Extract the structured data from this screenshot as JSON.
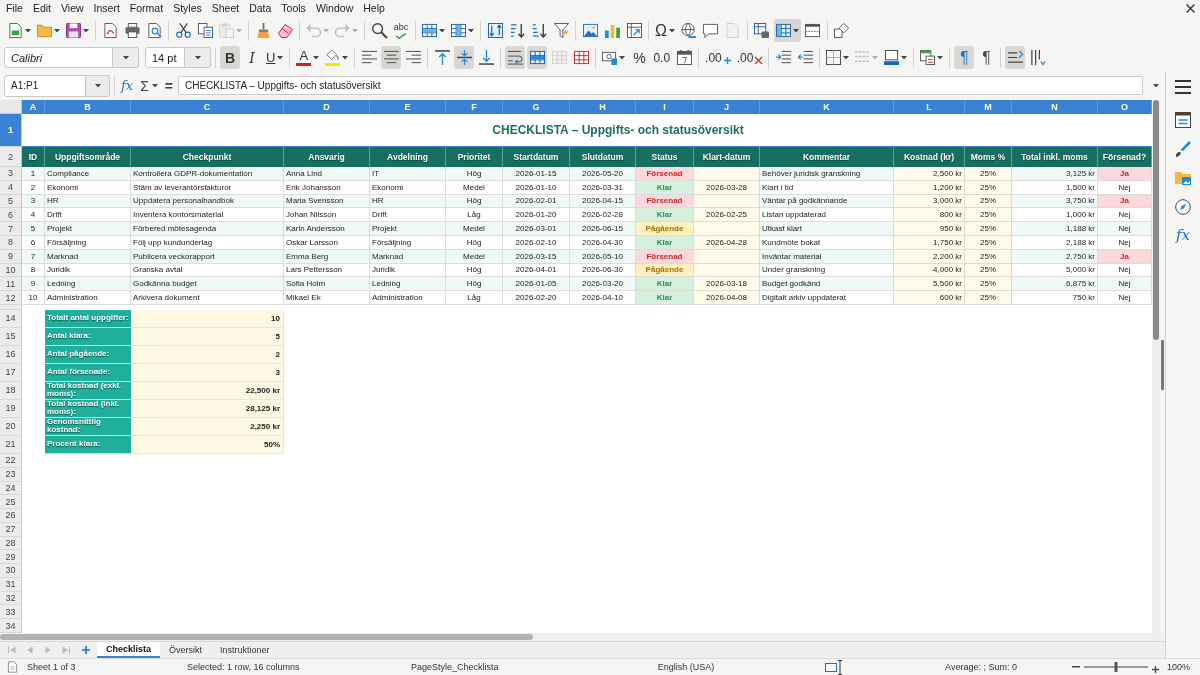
{
  "menu_bar": {
    "items": [
      "File",
      "Edit",
      "View",
      "Insert",
      "Format",
      "Styles",
      "Sheet",
      "Data",
      "Tools",
      "Window",
      "Help"
    ]
  },
  "standard_toolbar": {
    "groups": [
      [
        {
          "kind": "new",
          "menu": true,
          "pressed": false,
          "disabled": false
        },
        {
          "kind": "open",
          "menu": true,
          "pressed": false,
          "disabled": false
        },
        {
          "kind": "save",
          "menu": true,
          "pressed": false,
          "disabled": false
        }
      ],
      [
        {
          "kind": "pdf",
          "menu": false,
          "pressed": false,
          "disabled": false
        },
        {
          "kind": "print",
          "menu": false,
          "pressed": false,
          "disabled": false
        },
        {
          "kind": "preview",
          "menu": false,
          "pressed": false,
          "disabled": false
        }
      ],
      [
        {
          "kind": "cut",
          "menu": false,
          "pressed": false,
          "disabled": false
        },
        {
          "kind": "copy",
          "menu": false,
          "pressed": false,
          "disabled": false
        },
        {
          "kind": "paste",
          "menu": true,
          "pressed": false,
          "disabled": true
        }
      ],
      [
        {
          "kind": "clone",
          "menu": false,
          "pressed": false,
          "disabled": false
        },
        {
          "kind": "clear",
          "menu": false,
          "pressed": false,
          "disabled": false
        }
      ],
      [
        {
          "kind": "undo",
          "menu": true,
          "pressed": false,
          "disabled": true
        },
        {
          "kind": "redo",
          "menu": true,
          "pressed": false,
          "disabled": true
        }
      ],
      [
        {
          "kind": "find",
          "menu": false,
          "pressed": false,
          "disabled": false
        },
        {
          "kind": "spelling",
          "label": "abc",
          "menu": false,
          "pressed": false,
          "disabled": false
        }
      ],
      [
        {
          "kind": "rows",
          "menu": true,
          "pressed": false,
          "disabled": false
        },
        {
          "kind": "columns",
          "menu": true,
          "pressed": false,
          "disabled": false
        }
      ],
      [
        {
          "kind": "sort",
          "menu": false,
          "pressed": false,
          "disabled": false
        },
        {
          "kind": "sortup",
          "menu": false,
          "pressed": false,
          "disabled": false
        },
        {
          "kind": "sortdown",
          "menu": false,
          "pressed": false,
          "disabled": false
        },
        {
          "kind": "filter",
          "menu": false,
          "pressed": false,
          "disabled": false
        }
      ],
      [
        {
          "kind": "image",
          "menu": false,
          "pressed": false,
          "disabled": false
        },
        {
          "kind": "chart",
          "menu": false,
          "pressed": false,
          "disabled": false
        },
        {
          "kind": "pivot",
          "menu": false,
          "pressed": false,
          "disabled": false
        }
      ],
      [
        {
          "kind": "symbol",
          "label": "Ω",
          "menu": true,
          "pressed": false,
          "disabled": false
        },
        {
          "kind": "link",
          "menu": false,
          "pressed": false,
          "disabled": false
        },
        {
          "kind": "comment",
          "menu": false,
          "pressed": false,
          "disabled": false
        },
        {
          "kind": "headers",
          "menu": false,
          "pressed": false,
          "disabled": true
        }
      ],
      [
        {
          "kind": "printrange",
          "menu": false,
          "pressed": false,
          "disabled": false
        },
        {
          "kind": "freeze",
          "menu": true,
          "pressed": true,
          "disabled": false
        },
        {
          "kind": "split",
          "menu": false,
          "pressed": false,
          "disabled": false
        }
      ],
      [
        {
          "kind": "draw",
          "menu": false,
          "pressed": false,
          "disabled": false
        }
      ]
    ]
  },
  "formatting_toolbar": {
    "font_name": "Calibri",
    "font_size": "14 pt",
    "groups": [
      [
        {
          "kind": "bold",
          "label": "B",
          "menu": false,
          "pressed": true,
          "disabled": false
        },
        {
          "kind": "italic",
          "label": "I",
          "menu": false,
          "pressed": false,
          "disabled": false
        },
        {
          "kind": "underline",
          "label": "U",
          "menu": true,
          "pressed": false,
          "disabled": false
        }
      ],
      [
        {
          "kind": "fontcolor",
          "label": "A",
          "color": "#c62828",
          "menu": true,
          "pressed": false,
          "disabled": false
        },
        {
          "kind": "highlight",
          "color": "#f7e600",
          "menu": true,
          "pressed": false,
          "disabled": false
        }
      ],
      [
        {
          "kind": "alignleft",
          "menu": false,
          "pressed": false,
          "disabled": false
        },
        {
          "kind": "aligncenter",
          "menu": false,
          "pressed": true,
          "disabled": false
        },
        {
          "kind": "alignright",
          "menu": false,
          "pressed": false,
          "disabled": false
        }
      ],
      [
        {
          "kind": "aligntop",
          "menu": false,
          "pressed": false,
          "disabled": false
        },
        {
          "kind": "alignmiddle",
          "menu": false,
          "pressed": true,
          "disabled": false
        },
        {
          "kind": "alignbottom",
          "menu": false,
          "pressed": false,
          "disabled": false
        }
      ],
      [
        {
          "kind": "wrap",
          "menu": false,
          "pressed": true,
          "disabled": false
        },
        {
          "kind": "mergecenter",
          "menu": false,
          "pressed": true,
          "disabled": false
        },
        {
          "kind": "merge",
          "menu": false,
          "pressed": false,
          "disabled": true
        },
        {
          "kind": "unmerge",
          "menu": false,
          "pressed": false,
          "disabled": false
        }
      ],
      [
        {
          "kind": "currency",
          "menu": true,
          "pressed": false,
          "disabled": false
        },
        {
          "kind": "percent",
          "label": "%",
          "menu": false,
          "pressed": false,
          "disabled": false
        },
        {
          "kind": "number",
          "label": "0.0",
          "menu": false,
          "pressed": false,
          "disabled": false
        },
        {
          "kind": "date",
          "menu": false,
          "pressed": false,
          "disabled": false
        }
      ],
      [
        {
          "kind": "adddecimal",
          "label": ".00",
          "menu": false,
          "pressed": false,
          "disabled": false
        },
        {
          "kind": "deldecimal",
          "label": ".00",
          "menu": false,
          "pressed": false,
          "disabled": false
        }
      ],
      [
        {
          "kind": "indent",
          "menu": false,
          "pressed": false,
          "disabled": false
        },
        {
          "kind": "outdent",
          "menu": false,
          "pressed": false,
          "disabled": false
        }
      ],
      [
        {
          "kind": "borders",
          "menu": true,
          "pressed": false,
          "disabled": false
        },
        {
          "kind": "borderstyle",
          "menu": true,
          "pressed": false,
          "disabled": true
        },
        {
          "kind": "bordercolor",
          "menu": true,
          "pressed": false,
          "disabled": false
        }
      ],
      [
        {
          "kind": "conditional",
          "menu": true,
          "pressed": false,
          "disabled": false
        }
      ],
      [
        {
          "kind": "ltr",
          "label": "¶",
          "menu": false,
          "pressed": true,
          "disabled": false
        },
        {
          "kind": "rtl",
          "label": "¶",
          "menu": false,
          "pressed": false,
          "disabled": false
        }
      ],
      [
        {
          "kind": "horizontal",
          "menu": false,
          "pressed": true,
          "disabled": false
        },
        {
          "kind": "vertical",
          "menu": false,
          "pressed": false,
          "disabled": false
        }
      ]
    ]
  },
  "formula_bar": {
    "name_box": "A1:P1",
    "function_wizard": "fx",
    "sum": "Σ",
    "equals": "=",
    "content": "CHECKLISTA – Uppgifts- och statusöversikt"
  },
  "sheet": {
    "columns": [
      {
        "label": "A",
        "selected": true
      },
      {
        "label": "B",
        "selected": true
      },
      {
        "label": "C",
        "selected": true
      },
      {
        "label": "D",
        "selected": true
      },
      {
        "label": "E",
        "selected": true
      },
      {
        "label": "F",
        "selected": true
      },
      {
        "label": "G",
        "selected": true
      },
      {
        "label": "H",
        "selected": true
      },
      {
        "label": "I",
        "selected": true
      },
      {
        "label": "J",
        "selected": true
      },
      {
        "label": "K",
        "selected": true
      },
      {
        "label": "L",
        "selected": true
      },
      {
        "label": "M",
        "selected": true
      },
      {
        "label": "N",
        "selected": true
      },
      {
        "label": "O",
        "selected": true
      }
    ],
    "title_row": {
      "row": "1",
      "selected": true,
      "title": "CHECKLISTA – Uppgifts- och statusöversikt"
    },
    "header_row": {
      "row": "2",
      "selected": false,
      "cells": [
        "ID",
        "Uppgiftsområde",
        "Checkpunkt",
        "Ansvarig",
        "Avdelning",
        "Prioritet",
        "Startdatum",
        "Slutdatum",
        "Status",
        "Klart-datum",
        "Kommentar",
        "Kostnad (kr)",
        "Moms %",
        "Total inkl. moms",
        "Försenad?"
      ]
    },
    "rows": [
      {
        "row": "3",
        "selected": false,
        "id": "1",
        "area": "Compliance",
        "checkpoint": "Kontrollera GDPR-dokumentation",
        "owner": "Anna Lind",
        "department": "IT",
        "priority": "Hög",
        "start": "2026-01-15",
        "end": "2026-05-20",
        "status": {
          "text": "Försenad",
          "kind": "late"
        },
        "comment": "Behöver juridisk granskning",
        "cost": "2,500 kr",
        "vat": "25%",
        "total": "3,125 kr",
        "overdue": {
          "text": "Ja",
          "flagged": true
        }
      },
      {
        "row": "4",
        "selected": false,
        "id": "2",
        "area": "Ekonomi",
        "checkpoint": "Stäm av leverantörsfakturor",
        "owner": "Erik Johansson",
        "department": "Ekonomi",
        "priority": "Medel",
        "start": "2026-01-10",
        "end": "2026-03-31",
        "status": {
          "text": "Klar",
          "kind": "done"
        },
        "done_date": "2026-03-28",
        "comment": "Klart i tid",
        "cost": "1,200 kr",
        "vat": "25%",
        "total": "1,500 kr",
        "overdue": {
          "text": "Nej",
          "flagged": false
        }
      },
      {
        "row": "5",
        "selected": false,
        "id": "3",
        "area": "HR",
        "checkpoint": "Uppdatera personalhandbok",
        "owner": "Maria Svensson",
        "department": "HR",
        "priority": "Hög",
        "start": "2026-02-01",
        "end": "2026-04-15",
        "status": {
          "text": "Försenad",
          "kind": "late"
        },
        "comment": "Väntar på godkännande",
        "cost": "3,000 kr",
        "vat": "25%",
        "total": "3,750 kr",
        "overdue": {
          "text": "Ja",
          "flagged": true
        }
      },
      {
        "row": "6",
        "selected": false,
        "id": "4",
        "area": "Drift",
        "checkpoint": "Inventera kontorsmaterial",
        "owner": "Johan Nilsson",
        "department": "Drift",
        "priority": "Låg",
        "start": "2026-01-20",
        "end": "2026-02-28",
        "status": {
          "text": "Klar",
          "kind": "done"
        },
        "done_date": "2026-02-25",
        "comment": "Listan uppdaterad",
        "cost": "800 kr",
        "vat": "25%",
        "total": "1,000 kr",
        "overdue": {
          "text": "Nej",
          "flagged": false
        }
      },
      {
        "row": "7",
        "selected": false,
        "id": "5",
        "area": "Projekt",
        "checkpoint": "Förbered mötesagenda",
        "owner": "Karin Andersson",
        "department": "Projekt",
        "priority": "Medel",
        "start": "2026-03-01",
        "end": "2026-06-15",
        "status": {
          "text": "Pågående",
          "kind": "ongoing"
        },
        "comment": "Utkast klart",
        "cost": "950 kr",
        "vat": "25%",
        "total": "1,188 kr",
        "overdue": {
          "text": "Nej",
          "flagged": false
        }
      },
      {
        "row": "8",
        "selected": false,
        "id": "6",
        "area": "Försäljning",
        "checkpoint": "Följ upp kundunderlag",
        "owner": "Oskar Larsson",
        "department": "Försäljning",
        "priority": "Hög",
        "start": "2026-02-10",
        "end": "2026-04-30",
        "status": {
          "text": "Klar",
          "kind": "done"
        },
        "done_date": "2026-04-28",
        "comment": "Kundmöte bokat",
        "cost": "1,750 kr",
        "vat": "25%",
        "total": "2,188 kr",
        "overdue": {
          "text": "Nej",
          "flagged": false
        }
      },
      {
        "row": "9",
        "selected": false,
        "id": "7",
        "area": "Marknad",
        "checkpoint": "Publicera veckorapport",
        "owner": "Emma Berg",
        "department": "Marknad",
        "priority": "Medel",
        "start": "2026-03-15",
        "end": "2026-05-10",
        "status": {
          "text": "Försenad",
          "kind": "late"
        },
        "comment": "Inväntar material",
        "cost": "2,200 kr",
        "vat": "25%",
        "total": "2,750 kr",
        "overdue": {
          "text": "Ja",
          "flagged": true
        }
      },
      {
        "row": "10",
        "selected": false,
        "id": "8",
        "area": "Juridik",
        "checkpoint": "Granska avtal",
        "owner": "Lars Pettersson",
        "department": "Juridik",
        "priority": "Hög",
        "start": "2026-04-01",
        "end": "2026-06-30",
        "status": {
          "text": "Pågående",
          "kind": "ongoing"
        },
        "comment": "Under granskning",
        "cost": "4,000 kr",
        "vat": "25%",
        "total": "5,000 kr",
        "overdue": {
          "text": "Nej",
          "flagged": false
        }
      },
      {
        "row": "11",
        "selected": false,
        "id": "9",
        "area": "Ledning",
        "checkpoint": "Godkänna budget",
        "owner": "Sofia Holm",
        "department": "Ledning",
        "priority": "Hög",
        "start": "2026-01-05",
        "end": "2026-03-20",
        "status": {
          "text": "Klar",
          "kind": "done"
        },
        "done_date": "2026-03-18",
        "comment": "Budget godkänd",
        "cost": "5,500 kr",
        "vat": "25%",
        "total": "6,875 kr",
        "overdue": {
          "text": "Nej",
          "flagged": false
        }
      },
      {
        "row": "12",
        "selected": false,
        "id": "10",
        "area": "Administration",
        "checkpoint": "Arkivera dokument",
        "owner": "Mikael Ek",
        "department": "Administration",
        "priority": "Låg",
        "start": "2026-02-20",
        "end": "2026-04-10",
        "status": {
          "text": "Klar",
          "kind": "done"
        },
        "done_date": "2026-04-08",
        "comment": "Digitalt arkiv uppdaterat",
        "cost": "600 kr",
        "vat": "25%",
        "total": "750 kr",
        "overdue": {
          "text": "Nej",
          "flagged": false
        }
      }
    ],
    "summary": [
      {
        "row": "14",
        "selected": false,
        "label": "Totalt antal uppgifter:",
        "value": "10"
      },
      {
        "row": "15",
        "selected": false,
        "label": "Antal klara:",
        "value": "5"
      },
      {
        "row": "16",
        "selected": false,
        "label": "Antal pågående:",
        "value": "2"
      },
      {
        "row": "17",
        "selected": false,
        "label": "Antal försenade:",
        "value": "3"
      },
      {
        "row": "18",
        "selected": false,
        "label": "Total kostnad (exkl. moms):",
        "value": "22,500 kr"
      },
      {
        "row": "19",
        "selected": false,
        "label": "Total kostnad (inkl. moms):",
        "value": "28,125 kr"
      },
      {
        "row": "20",
        "selected": false,
        "label": "Genomsnittlig kostnad:",
        "value": "2,250 kr"
      },
      {
        "row": "21",
        "selected": false,
        "label": "Procent klara:",
        "value": "50%"
      }
    ],
    "empty_rows": [
      {
        "row": "22",
        "selected": false
      },
      {
        "row": "23",
        "selected": false
      },
      {
        "row": "24",
        "selected": false
      },
      {
        "row": "25",
        "selected": false
      },
      {
        "row": "26",
        "selected": false
      },
      {
        "row": "27",
        "selected": false
      },
      {
        "row": "28",
        "selected": false
      },
      {
        "row": "29",
        "selected": false
      },
      {
        "row": "30",
        "selected": false
      },
      {
        "row": "31",
        "selected": false
      },
      {
        "row": "32",
        "selected": false
      },
      {
        "row": "33",
        "selected": false
      },
      {
        "row": "34",
        "selected": false
      }
    ]
  },
  "sheet_tabs": {
    "tabs": [
      {
        "label": "Checklista",
        "selected": true
      },
      {
        "label": "Översikt",
        "selected": false
      },
      {
        "label": "Instruktioner",
        "selected": false
      }
    ]
  },
  "sidebar": {
    "tabs": [
      {
        "kind": "properties"
      },
      {
        "kind": "styles"
      },
      {
        "kind": "gallery"
      },
      {
        "kind": "navigator"
      },
      {
        "kind": "functions",
        "label": "fx"
      }
    ]
  },
  "status_bar": {
    "sheet": "Sheet 1 of 3",
    "selection": "Selected: 1 row, 16 columns",
    "page_style": "PageStyle_Checklista",
    "language": "English (USA)",
    "statistics": "Average: ; Sum: 0",
    "zoom": {
      "level": 0.5,
      "reading": "100%"
    }
  }
}
